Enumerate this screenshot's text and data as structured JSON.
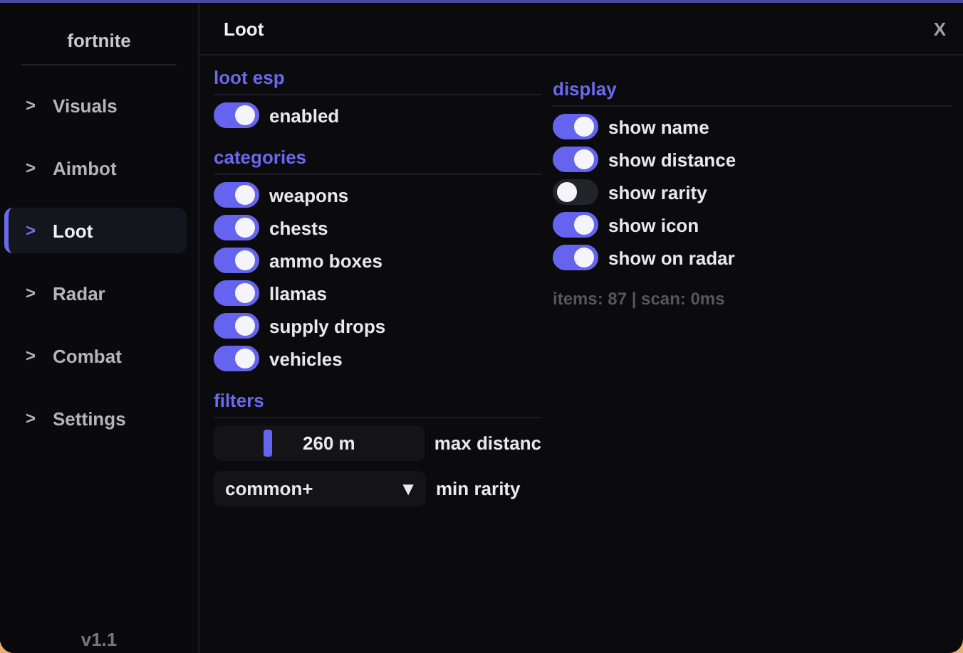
{
  "sidebar": {
    "title": "fortnite",
    "items": [
      {
        "arrow": ">",
        "label": "Visuals",
        "selected": false
      },
      {
        "arrow": ">",
        "label": "Aimbot",
        "selected": false
      },
      {
        "arrow": ">",
        "label": "Loot",
        "selected": true
      },
      {
        "arrow": ">",
        "label": "Radar",
        "selected": false
      },
      {
        "arrow": ">",
        "label": "Combat",
        "selected": false
      },
      {
        "arrow": ">",
        "label": "Settings",
        "selected": false
      }
    ],
    "version": "v1.1"
  },
  "header": {
    "title": "Loot",
    "close": "X"
  },
  "left": [
    {
      "heading": "loot esp",
      "toggles": [
        {
          "label": "enabled",
          "on": true
        }
      ]
    },
    {
      "heading": "categories",
      "toggles": [
        {
          "label": "weapons",
          "on": true
        },
        {
          "label": "chests",
          "on": true
        },
        {
          "label": "ammo boxes",
          "on": true
        },
        {
          "label": "llamas",
          "on": true
        },
        {
          "label": "supply drops",
          "on": true
        },
        {
          "label": "vehicles",
          "on": true
        }
      ]
    }
  ],
  "filters": {
    "heading": "filters",
    "slider": {
      "value": "260 m",
      "label": "max distanc",
      "level": 0.24
    },
    "dropdown": {
      "value": "common+",
      "caret": "▼",
      "label": "min rarity"
    }
  },
  "display": {
    "heading": "display",
    "toggles": [
      {
        "label": "show name",
        "on": true
      },
      {
        "label": "show distance",
        "on": true
      },
      {
        "label": "show rarity",
        "on": false
      },
      {
        "label": "show icon",
        "on": true
      },
      {
        "label": "show on radar",
        "on": true
      }
    ],
    "stats": "items: 87 | scan: 0ms"
  }
}
